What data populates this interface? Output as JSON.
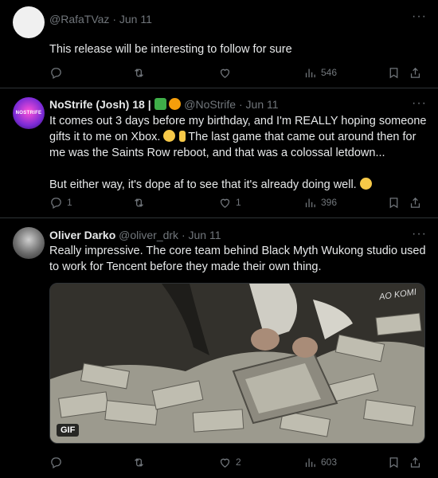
{
  "posts": [
    {
      "handle": "@RafaTVaz",
      "time": "Jun 11",
      "text": "This release will be interesting to follow for sure",
      "actions": {
        "reply": "",
        "repost": "",
        "like": "",
        "views": "546"
      }
    },
    {
      "name": "NoStrife (Josh)",
      "badges": "18 |",
      "handle": "@NoStrife",
      "time": "Jun 11",
      "avatar_text": "NOSTRIFE",
      "text1": "It comes out 3 days before my birthday, and I'm REALLY hoping someone gifts it to me on Xbox.",
      "text1b": "The last game that came out around then for me was the Saints Row reboot, and that was a colossal letdown...",
      "text2": "But either way, it's dope af to see that it's already doing well.",
      "actions": {
        "reply": "1",
        "repost": "",
        "like": "1",
        "views": "396"
      }
    },
    {
      "name": "Oliver Darko",
      "handle": "@oliver_drk",
      "time": "Jun 11",
      "text": "Really impressive. The core team behind Black Myth Wukong studio used to work for Tencent before they made their own thing.",
      "media": {
        "gif_label": "GIF",
        "watermark": "AO KOMI"
      },
      "actions": {
        "reply": "",
        "repost": "",
        "like": "2",
        "views": "603"
      }
    }
  ],
  "separator": "·",
  "colors": {
    "background": "#000000",
    "text": "#e7e9ea",
    "muted": "#71767b",
    "border": "#2f3336"
  }
}
